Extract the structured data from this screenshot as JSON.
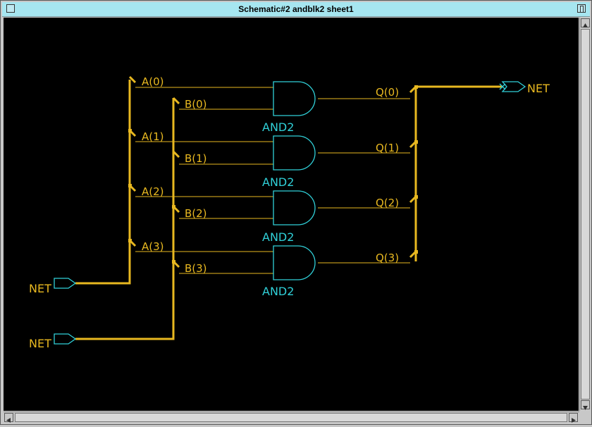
{
  "window": {
    "title": "Schematic#2 andblk2 sheet1"
  },
  "colors": {
    "wire": "#e8b820",
    "gate": "#30d0d8",
    "canvas": "#000000",
    "titlebar": "#a6e6f0"
  },
  "schematic": {
    "inputs_a": [
      "A(0)",
      "A(1)",
      "A(2)",
      "A(3)"
    ],
    "inputs_b": [
      "B(0)",
      "B(1)",
      "B(2)",
      "B(3)"
    ],
    "outputs": [
      "Q(0)",
      "Q(1)",
      "Q(2)",
      "Q(3)"
    ],
    "gates": [
      "AND2",
      "AND2",
      "AND2",
      "AND2"
    ],
    "ports": {
      "input_a": "NET",
      "input_b": "NET",
      "output": "NET"
    }
  }
}
